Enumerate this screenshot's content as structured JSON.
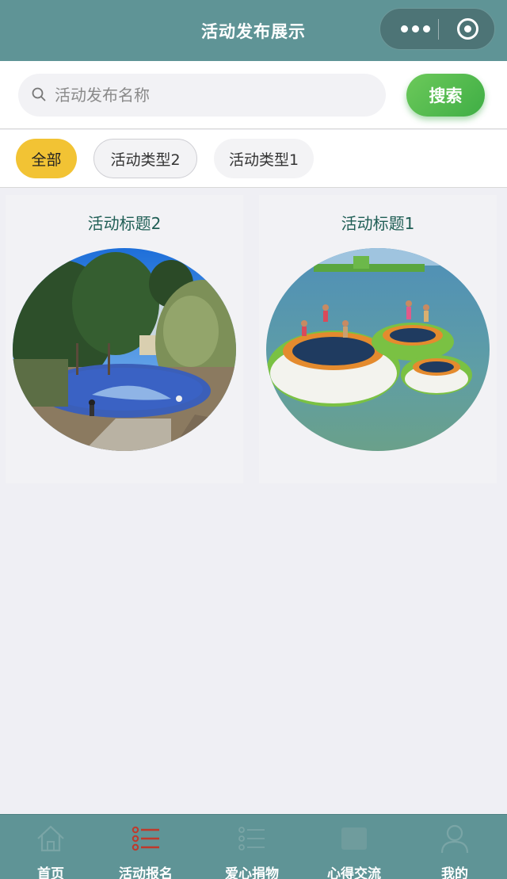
{
  "navbar": {
    "title": "活动发布展示"
  },
  "search": {
    "placeholder": "活动发布名称",
    "button_label": "搜索"
  },
  "filter_tabs": [
    {
      "label": "全部",
      "active": true
    },
    {
      "label": "活动类型2",
      "active": false
    },
    {
      "label": "活动类型1",
      "active": false
    }
  ],
  "cards": [
    {
      "title": "活动标题2",
      "image": "outdoor-playground-photo"
    },
    {
      "title": "活动标题1",
      "image": "water-trampolines-photo"
    }
  ],
  "tabbar": [
    {
      "label": "首页",
      "icon": "home-icon"
    },
    {
      "label": "活动报名",
      "icon": "list-icon",
      "active": true
    },
    {
      "label": "爱心捐物",
      "icon": "list-icon"
    },
    {
      "label": "心得交流",
      "icon": "chat-icon"
    },
    {
      "label": "我的",
      "icon": "user-icon"
    }
  ],
  "colors": {
    "navbar": "#5f9496",
    "accent_yellow": "#f2c334",
    "search_green": "#3fae45",
    "active_tab_icon": "#c0392b",
    "card_title": "#1f5e55"
  }
}
